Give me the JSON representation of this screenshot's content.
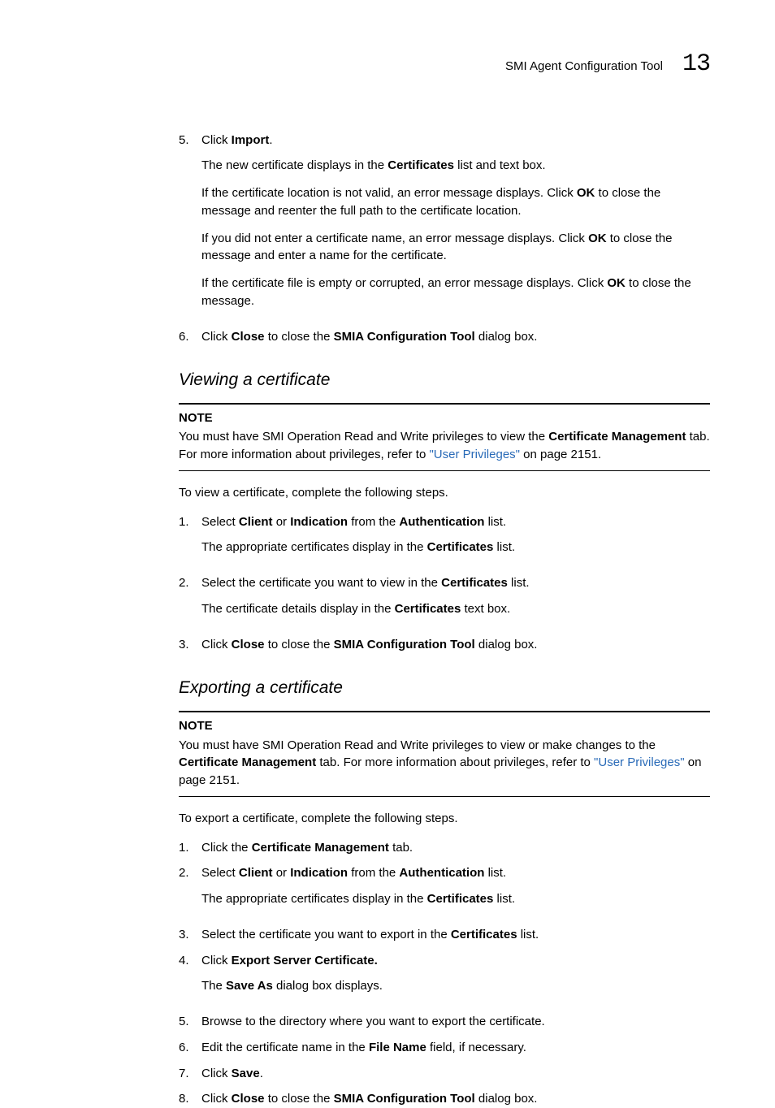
{
  "header": {
    "title": "SMI Agent Configuration Tool",
    "chapter": "13"
  },
  "intro_list": {
    "item5": {
      "num": "5.",
      "t1a": "Click ",
      "t1b": "Import",
      "t1c": ".",
      "s1a": "The new certificate displays in the ",
      "s1b": "Certificates",
      "s1c": " list and text box.",
      "s2a": "If the certificate location is not valid, an error message displays. Click ",
      "s2b": "OK",
      "s2c": " to close the message and reenter the full path to the certificate location.",
      "s3a": "If you did not enter a certificate name, an error message displays. Click ",
      "s3b": "OK",
      "s3c": " to close the message and enter a name for the certificate.",
      "s4a": "If the certificate file is empty or corrupted, an error message displays. Click ",
      "s4b": "OK",
      "s4c": " to close the message."
    },
    "item6": {
      "num": "6.",
      "a": "Click ",
      "b": "Close",
      "c": " to close the ",
      "d": "SMIA Configuration Tool",
      "e": " dialog box."
    }
  },
  "viewing": {
    "heading": "Viewing a certificate",
    "note_label": "NOTE",
    "note_a": "You must have SMI Operation Read and Write privileges to view the ",
    "note_b": "Certificate Management",
    "note_c": " tab. For more information about privileges, refer to ",
    "note_link": "\"User Privileges\"",
    "note_d": " on page 2151.",
    "lead": "To view a certificate, complete the following steps.",
    "i1": {
      "num": "1.",
      "a": "Select ",
      "b": "Client",
      "c": " or ",
      "d": "Indication",
      "e": " from the ",
      "f": "Authentication",
      "g": " list.",
      "s1a": "The appropriate certificates display in the ",
      "s1b": "Certificates",
      "s1c": " list."
    },
    "i2": {
      "num": "2.",
      "a": "Select the certificate you want to view in the ",
      "b": "Certificates",
      "c": " list.",
      "s1a": "The certificate details display in the ",
      "s1b": "Certificates",
      "s1c": " text box."
    },
    "i3": {
      "num": "3.",
      "a": "Click ",
      "b": "Close",
      "c": " to close the ",
      "d": "SMIA Configuration Tool",
      "e": " dialog box."
    }
  },
  "exporting": {
    "heading": "Exporting a certificate",
    "note_label": "NOTE",
    "note_a": "You must have SMI Operation Read and Write privileges to view or make changes to the ",
    "note_b": "Certificate Management",
    "note_c": " tab. For more information about privileges, refer to ",
    "note_link": "\"User Privileges\"",
    "note_d": " on page 2151.",
    "lead": "To export a certificate, complete the following steps.",
    "i1": {
      "num": "1.",
      "a": "Click the ",
      "b": "Certificate Management",
      "c": " tab."
    },
    "i2": {
      "num": "2.",
      "a": "Select ",
      "b": "Client",
      "c": " or ",
      "d": "Indication",
      "e": " from the ",
      "f": "Authentication",
      "g": " list.",
      "s1a": "The appropriate certificates display in the ",
      "s1b": "Certificates",
      "s1c": " list."
    },
    "i3": {
      "num": "3.",
      "a": "Select the certificate you want to export in the ",
      "b": "Certificates",
      "c": " list."
    },
    "i4": {
      "num": "4.",
      "a": "Click ",
      "b": "Export Server Certificate",
      "c": ".",
      "s1a": "The ",
      "s1b": "Save As",
      "s1c": " dialog box displays."
    },
    "i5": {
      "num": "5.",
      "a": "Browse to the directory where you want to export the certificate."
    },
    "i6": {
      "num": "6.",
      "a": "Edit the certificate name in the ",
      "b": "File Name",
      "c": " field, if necessary."
    },
    "i7": {
      "num": "7.",
      "a": "Click ",
      "b": "Save",
      "c": "."
    },
    "i8": {
      "num": "8.",
      "a": "Click ",
      "b": "Close",
      "c": " to close the ",
      "d": "SMIA Configuration Tool",
      "e": " dialog box."
    }
  }
}
